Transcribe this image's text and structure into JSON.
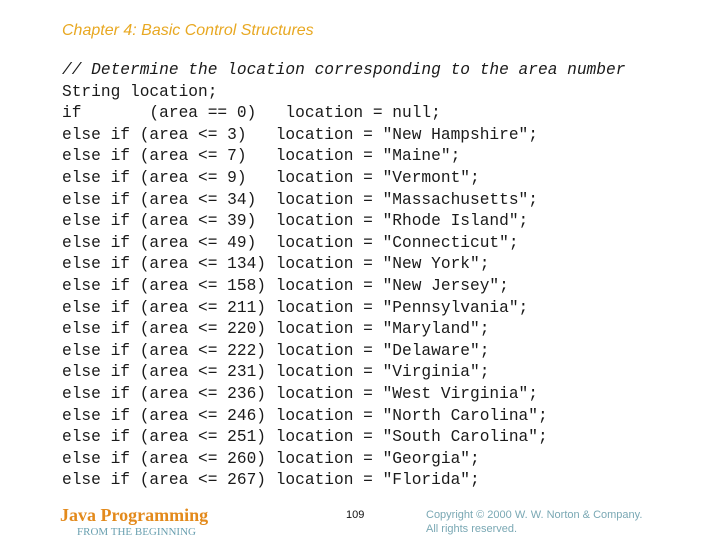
{
  "header": {
    "chapter_title": "Chapter 4: Basic Control Structures"
  },
  "code": {
    "comment": "// Determine the location corresponding to the area number",
    "declaration": "String location;",
    "lines": [
      {
        "keyword": "if",
        "condition": "(area == 0)",
        "target": "location",
        "value": "null",
        "text": "if       (area == 0)   location = null;"
      },
      {
        "keyword": "else if",
        "condition": "(area <= 3)",
        "target": "location",
        "value": "\"New Hampshire\"",
        "text": "else if (area <= 3)   location = \"New Hampshire\";"
      },
      {
        "keyword": "else if",
        "condition": "(area <= 7)",
        "target": "location",
        "value": "\"Maine\"",
        "text": "else if (area <= 7)   location = \"Maine\";"
      },
      {
        "keyword": "else if",
        "condition": "(area <= 9)",
        "target": "location",
        "value": "\"Vermont\"",
        "text": "else if (area <= 9)   location = \"Vermont\";"
      },
      {
        "keyword": "else if",
        "condition": "(area <= 34)",
        "target": "location",
        "value": "\"Massachusetts\"",
        "text": "else if (area <= 34)  location = \"Massachusetts\";"
      },
      {
        "keyword": "else if",
        "condition": "(area <= 39)",
        "target": "location",
        "value": "\"Rhode Island\"",
        "text": "else if (area <= 39)  location = \"Rhode Island\";"
      },
      {
        "keyword": "else if",
        "condition": "(area <= 49)",
        "target": "location",
        "value": "\"Connecticut\"",
        "text": "else if (area <= 49)  location = \"Connecticut\";"
      },
      {
        "keyword": "else if",
        "condition": "(area <= 134)",
        "target": "location",
        "value": "\"New York\"",
        "text": "else if (area <= 134) location = \"New York\";"
      },
      {
        "keyword": "else if",
        "condition": "(area <= 158)",
        "target": "location",
        "value": "\"New Jersey\"",
        "text": "else if (area <= 158) location = \"New Jersey\";"
      },
      {
        "keyword": "else if",
        "condition": "(area <= 211)",
        "target": "location",
        "value": "\"Pennsylvania\"",
        "text": "else if (area <= 211) location = \"Pennsylvania\";"
      },
      {
        "keyword": "else if",
        "condition": "(area <= 220)",
        "target": "location",
        "value": "\"Maryland\"",
        "text": "else if (area <= 220) location = \"Maryland\";"
      },
      {
        "keyword": "else if",
        "condition": "(area <= 222)",
        "target": "location",
        "value": "\"Delaware\"",
        "text": "else if (area <= 222) location = \"Delaware\";"
      },
      {
        "keyword": "else if",
        "condition": "(area <= 231)",
        "target": "location",
        "value": "\"Virginia\"",
        "text": "else if (area <= 231) location = \"Virginia\";"
      },
      {
        "keyword": "else if",
        "condition": "(area <= 236)",
        "target": "location",
        "value": "\"West Virginia\"",
        "text": "else if (area <= 236) location = \"West Virginia\";"
      },
      {
        "keyword": "else if",
        "condition": "(area <= 246)",
        "target": "location",
        "value": "\"North Carolina\"",
        "text": "else if (area <= 246) location = \"North Carolina\";"
      },
      {
        "keyword": "else if",
        "condition": "(area <= 251)",
        "target": "location",
        "value": "\"South Carolina\"",
        "text": "else if (area <= 251) location = \"South Carolina\";"
      },
      {
        "keyword": "else if",
        "condition": "(area <= 260)",
        "target": "location",
        "value": "\"Georgia\"",
        "text": "else if (area <= 260) location = \"Georgia\";"
      },
      {
        "keyword": "else if",
        "condition": "(area <= 267)",
        "target": "location",
        "value": "\"Florida\"",
        "text": "else if (area <= 267) location = \"Florida\";"
      }
    ]
  },
  "footer": {
    "logo_title": "Java Programming",
    "logo_subtitle": "FROM THE BEGINNING",
    "page_number": "109",
    "copyright_line1": "Copyright © 2000 W. W. Norton & Company.",
    "copyright_line2": "All rights reserved."
  },
  "colors": {
    "chapter_title": "#e8a822",
    "logo_title": "#e38a1c",
    "logo_subtitle": "#6aa0b0",
    "copyright": "#7aa8b4",
    "code_text": "#1a1a1a"
  }
}
